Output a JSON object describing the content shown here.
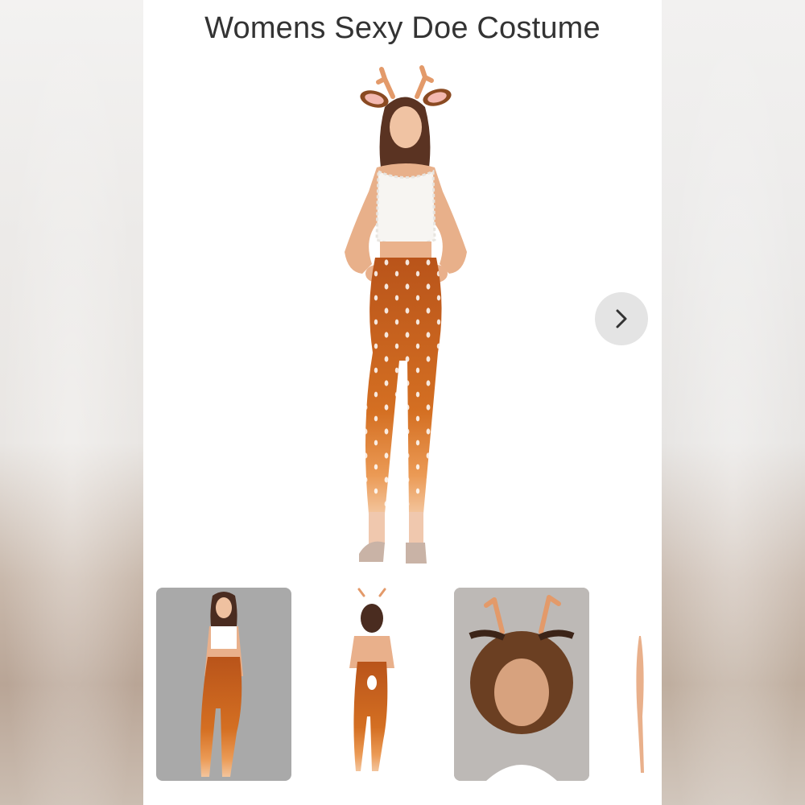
{
  "product": {
    "title": "Womens Sexy Doe Costume"
  },
  "gallery": {
    "main_image_icon": "woman-in-doe-costume-front",
    "next_button_icon": "chevron-right-icon",
    "thumbnails": [
      {
        "icon": "woman-in-doe-costume-grey-backdrop"
      },
      {
        "icon": "woman-in-doe-costume-back-view"
      },
      {
        "icon": "doe-headband-closeup"
      },
      {
        "icon": "partial-thumbnail"
      }
    ]
  },
  "colors": {
    "card_background": "#ffffff",
    "title_text": "#333333",
    "costume_orange": "#c8651f",
    "button_background": "#e4e4e4"
  }
}
